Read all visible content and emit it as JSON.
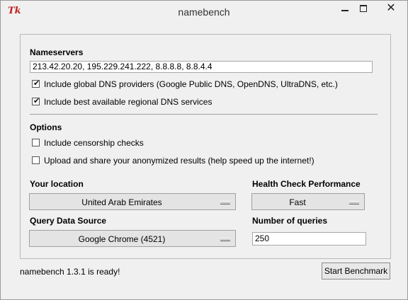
{
  "window": {
    "title": "namebench",
    "icon": "Tk",
    "controls": {
      "minimize": "minimize-icon",
      "maximize": "maximize-icon",
      "close": "✕"
    }
  },
  "nameservers": {
    "heading": "Nameservers",
    "value": "213.42.20.20, 195.229.241.222, 8.8.8.8, 8.8.4.4",
    "include_global": {
      "label": "Include global DNS providers (Google Public DNS, OpenDNS, UltraDNS, etc.)",
      "checked": true
    },
    "include_regional": {
      "label": "Include best available regional DNS services",
      "checked": true
    }
  },
  "options": {
    "heading": "Options",
    "censorship": {
      "label": "Include censorship checks",
      "checked": false
    },
    "upload": {
      "label": "Upload and share your anonymized results (help speed up the internet!)",
      "checked": false
    }
  },
  "location": {
    "heading": "Your location",
    "selected": "United Arab Emirates"
  },
  "health": {
    "heading": "Health Check Performance",
    "selected": "Fast"
  },
  "query_source": {
    "heading": "Query Data Source",
    "selected": "Google Chrome (4521)"
  },
  "queries": {
    "heading": "Number of queries",
    "value": "250"
  },
  "footer": {
    "status": "namebench 1.3.1 is ready!",
    "start_button": "Start Benchmark"
  }
}
